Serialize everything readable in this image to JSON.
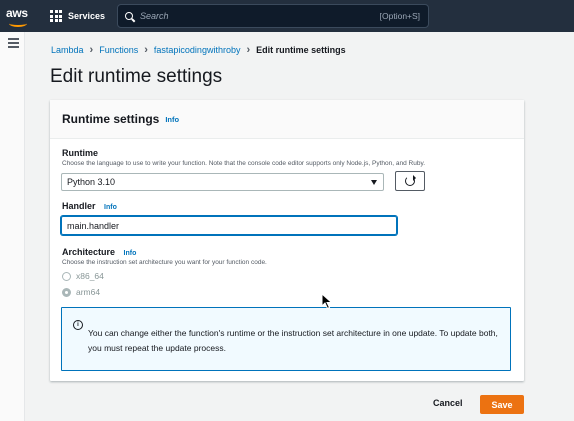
{
  "nav": {
    "logo_text": "aws",
    "services_label": "Services",
    "search_placeholder": "Search",
    "search_shortcut": "[Option+S]"
  },
  "breadcrumb": [
    "Lambda",
    "Functions",
    "fastapicodingwithroby",
    "Edit runtime settings"
  ],
  "page_title": "Edit runtime settings",
  "card": {
    "title": "Runtime settings",
    "title_info": "Info",
    "runtime": {
      "label": "Runtime",
      "description": "Choose the language to use to write your function. Note that the console code editor supports only Node.js, Python, and Ruby.",
      "selected": "Python 3.10"
    },
    "handler": {
      "label": "Handler",
      "info": "Info",
      "value": "main.handler"
    },
    "architecture": {
      "label": "Architecture",
      "info": "Info",
      "description": "Choose the instruction set architecture you want for your function code.",
      "options": [
        "x86_64",
        "arm64"
      ],
      "selected": "arm64"
    },
    "alert_text": "You can change either the function's runtime or the instruction set architecture in one update. To update both, you must repeat the update process."
  },
  "footer": {
    "cancel_label": "Cancel",
    "save_label": "Save"
  },
  "colors": {
    "nav_bg": "#232f3e",
    "link": "#0073bb",
    "primary_button": "#ec7211"
  }
}
